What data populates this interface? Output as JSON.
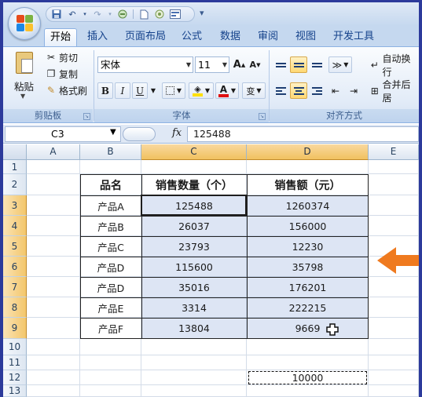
{
  "quick_access": {
    "icons": [
      "save-icon",
      "undo-icon",
      "redo-icon",
      "circle-icon",
      "new-doc-icon",
      "preview-icon",
      "sort-icon"
    ],
    "more": "▾"
  },
  "tabs": [
    "开始",
    "插入",
    "页面布局",
    "公式",
    "数据",
    "审阅",
    "视图",
    "开发工具"
  ],
  "active_tab": "开始",
  "ribbon": {
    "clipboard": {
      "paste": "粘贴",
      "cut": "剪切",
      "copy": "复制",
      "format_painter": "格式刷",
      "group_label": "剪贴板"
    },
    "font": {
      "font_name": "宋体",
      "font_size": "11",
      "grow": "A",
      "shrink": "A",
      "bold": "B",
      "italic": "I",
      "underline": "U",
      "phonetic": "变",
      "group_label": "字体",
      "font_color": "#e01010",
      "fill_color": "#ffe000"
    },
    "alignment": {
      "wrap_text": "自动换行",
      "merge_center": "合并后居",
      "group_label": "对齐方式"
    }
  },
  "formula_bar": {
    "name_box": "C3",
    "fx": "fx",
    "value": "125488"
  },
  "columns": [
    "A",
    "B",
    "C",
    "D",
    "E"
  ],
  "rows": [
    "1",
    "2",
    "3",
    "4",
    "5",
    "6",
    "7",
    "8",
    "9",
    "10",
    "11",
    "12",
    "13"
  ],
  "table": {
    "headers": [
      "品名",
      "销售数量（个）",
      "销售额（元）"
    ],
    "rows": [
      [
        "产品A",
        "125488",
        "1260374"
      ],
      [
        "产品B",
        "26037",
        "156000"
      ],
      [
        "产品C",
        "23793",
        "12230"
      ],
      [
        "产品D",
        "115600",
        "35798"
      ],
      [
        "产品D",
        "35016",
        "176201"
      ],
      [
        "产品E",
        "3314",
        "222215"
      ],
      [
        "产品F",
        "13804",
        "9669"
      ]
    ]
  },
  "copied_cell": {
    "ref": "D12",
    "value": "10000"
  },
  "colors": {
    "accent_arrow": "#ef7a1f",
    "selected_header": "#f3c76c",
    "selection_fill": "#b4c6e6"
  }
}
